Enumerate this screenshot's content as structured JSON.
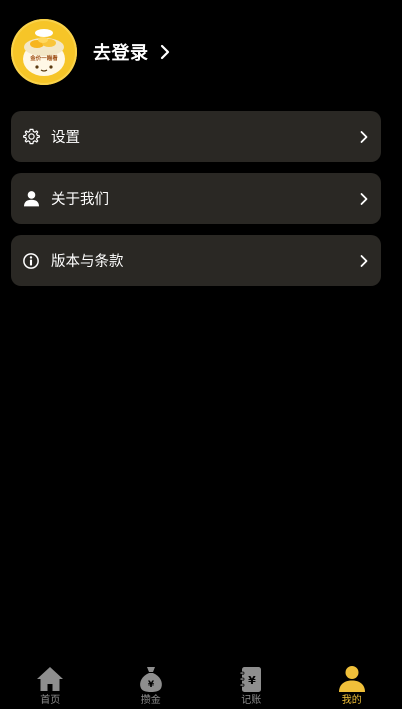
{
  "profile": {
    "avatar_text": "金价一瞄看",
    "login_label": "去登录"
  },
  "menu": {
    "items": [
      {
        "label": "设置",
        "icon": "gear-icon"
      },
      {
        "label": "关于我们",
        "icon": "user-icon"
      },
      {
        "label": "版本与条款",
        "icon": "info-icon"
      }
    ]
  },
  "tabbar": {
    "tabs": [
      {
        "label": "首页",
        "icon": "home-icon"
      },
      {
        "label": "攒金",
        "icon": "money-bag-icon"
      },
      {
        "label": "记账",
        "icon": "ledger-icon"
      },
      {
        "label": "我的",
        "icon": "profile-icon"
      }
    ],
    "active": "我的"
  },
  "colors": {
    "background": "#000000",
    "card": "#2a2824",
    "accent": "#f0c03a",
    "inactive_tab": "#8e8e8e"
  }
}
